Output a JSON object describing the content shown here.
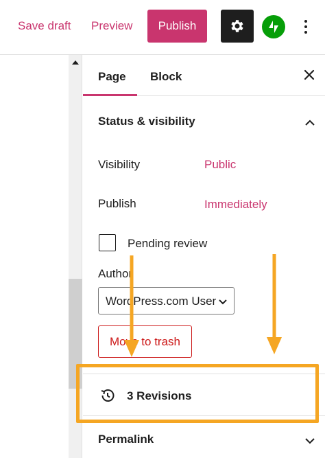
{
  "toolbar": {
    "save_draft": "Save draft",
    "preview": "Preview",
    "publish": "Publish",
    "settings_icon": "gear-icon",
    "jetpack_icon": "jetpack-icon",
    "more_icon": "vertical-ellipsis-icon"
  },
  "sidebar": {
    "tabs": [
      {
        "label": "Page",
        "active": true
      },
      {
        "label": "Block",
        "active": false
      }
    ],
    "close_icon": "close-icon",
    "status_panel": {
      "title": "Status & visibility",
      "expanded": true,
      "visibility_label": "Visibility",
      "visibility_value": "Public",
      "publish_label": "Publish",
      "publish_value": "Immediately",
      "pending_review_label": "Pending review",
      "pending_review_checked": false,
      "author_label": "Author",
      "author_value": "WordPress.com User",
      "trash_button": "Move to trash"
    },
    "revisions": {
      "icon": "history-icon",
      "label": "3 Revisions"
    },
    "permalink": {
      "title": "Permalink",
      "expanded": false
    }
  },
  "colors": {
    "accent": "#c9356e",
    "dark": "#1e1e1e",
    "danger": "#cc1818",
    "annotation": "#f5a623",
    "jetpack_green": "#069e08"
  }
}
